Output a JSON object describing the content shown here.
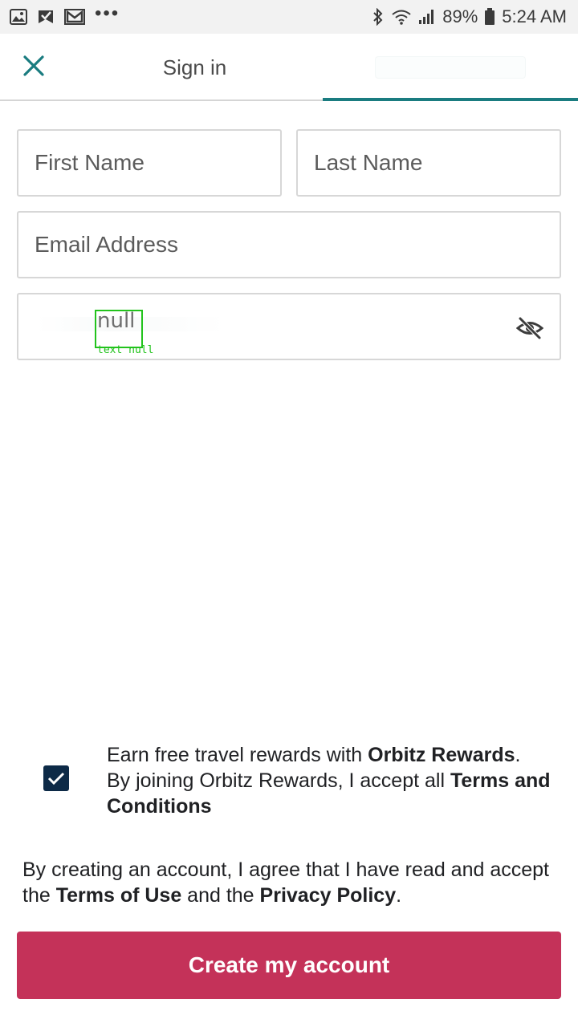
{
  "status_bar": {
    "left_icons": [
      "image-icon",
      "check-bookmark-icon",
      "gmail-icon",
      "more-notifications-icon"
    ],
    "right_icons": [
      "bluetooth-icon",
      "wifi-icon",
      "signal-icon",
      "battery-icon"
    ],
    "dots": "•••",
    "battery": "89%",
    "time": "5:24 AM"
  },
  "header": {
    "close_icon": "close-icon",
    "tab_signin": "Sign in",
    "accent_color": "#1a7c80"
  },
  "form": {
    "first_name_placeholder": "First Name",
    "last_name_placeholder": "Last Name",
    "email_placeholder": "Email Address",
    "password_overlay_text": "null",
    "password_overlay_caption": "text null",
    "visibility_icon": "eye-off-icon"
  },
  "rewards": {
    "checked": true,
    "line1_prefix": "Earn free travel rewards with ",
    "line1_brand": "Orbitz Rewards",
    "line1_suffix": ".",
    "line2_prefix": "By joining Orbitz Rewards, I accept all ",
    "terms_link": "Terms and Conditions"
  },
  "legal": {
    "prefix": "By creating an account, I agree that I have read and accept the ",
    "terms_of_use": "Terms of Use",
    "middle": " and the ",
    "privacy_policy": "Privacy Policy",
    "suffix": "."
  },
  "cta": {
    "label": "Create my account",
    "color": "#c43259"
  }
}
